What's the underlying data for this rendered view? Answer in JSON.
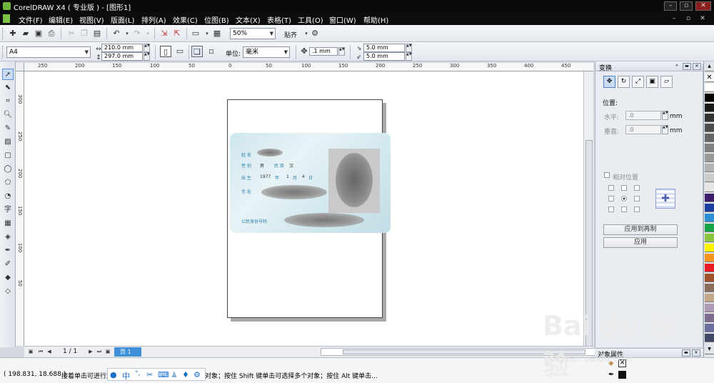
{
  "window": {
    "title": "CorelDRAW X4 ( 专业版 ) - [图形1]"
  },
  "menu": {
    "items": [
      "文件(F)",
      "编辑(E)",
      "视图(V)",
      "版面(L)",
      "排列(A)",
      "效果(C)",
      "位图(B)",
      "文本(X)",
      "表格(T)",
      "工具(O)",
      "窗口(W)",
      "帮助(H)"
    ]
  },
  "standard_toolbar": {
    "zoom": "50%",
    "snap_label": "贴齐"
  },
  "property_bar": {
    "paper_size": "A4",
    "width": "210.0 mm",
    "height": "297.0 mm",
    "units_label": "单位:",
    "units_value": "毫米",
    "nudge": ".1 mm",
    "dup_x": "5.0 mm",
    "dup_y": "5.0 mm"
  },
  "rulers": {
    "h_ticks": [
      "250",
      "200",
      "150",
      "100",
      "50",
      "0",
      "50",
      "100",
      "150",
      "200",
      "250",
      "300",
      "350",
      "400",
      "450"
    ],
    "v_ticks": [
      "300",
      "250",
      "200",
      "150",
      "100",
      "50"
    ]
  },
  "id_card": {
    "name_label": "姓 名",
    "sex_label": "性 别",
    "sex_value": "男",
    "ethnicity_label": "民 族",
    "ethnicity_value": "汉",
    "birth_label": "出 生",
    "birth_year": "1977",
    "birth_year_unit": "年",
    "birth_month": "1",
    "birth_month_unit": "月",
    "birth_day": "4",
    "birth_day_unit": "日",
    "address_label": "住 址",
    "id_label": "公民身份号码"
  },
  "page_nav": {
    "page_count": "1 / 1",
    "tab_label": "页 1"
  },
  "docker": {
    "title": "变换",
    "position_label": "位置:",
    "h_label": "水平:",
    "h_value": ".0",
    "v_label": "垂直:",
    "v_value": ".0",
    "unit": "mm",
    "relative_label": "相对位置",
    "apply_dup_label": "应用到再制",
    "apply_label": "应用",
    "second_title": "对象属性"
  },
  "palette": {
    "colors": [
      "#ffffff",
      "#000000",
      "#1a1a1a",
      "#333333",
      "#4d4d4d",
      "#666666",
      "#808080",
      "#999999",
      "#b3b3b3",
      "#cccccc",
      "#e6e6e6",
      "#3d1e6d",
      "#1d3fa0",
      "#2d8fd6",
      "#16a44b",
      "#8cc63f",
      "#fff200",
      "#f7941d",
      "#ed1c24",
      "#a0522d",
      "#8b6f5c",
      "#c5a88a",
      "#b09ab8",
      "#7e6b8f",
      "#6e6e9e",
      "#404a66"
    ]
  },
  "status": {
    "coords": "( 198.831, 18.688 )",
    "message": "接着单击可进行旋转/倾斜；双击工具，可选择所有对象；按住 Shift 键单击可选择多个对象；按住 Alt 键单击..."
  },
  "watermark": {
    "brand": "Bai du 经验",
    "url": "jingyan.baidu.com"
  }
}
